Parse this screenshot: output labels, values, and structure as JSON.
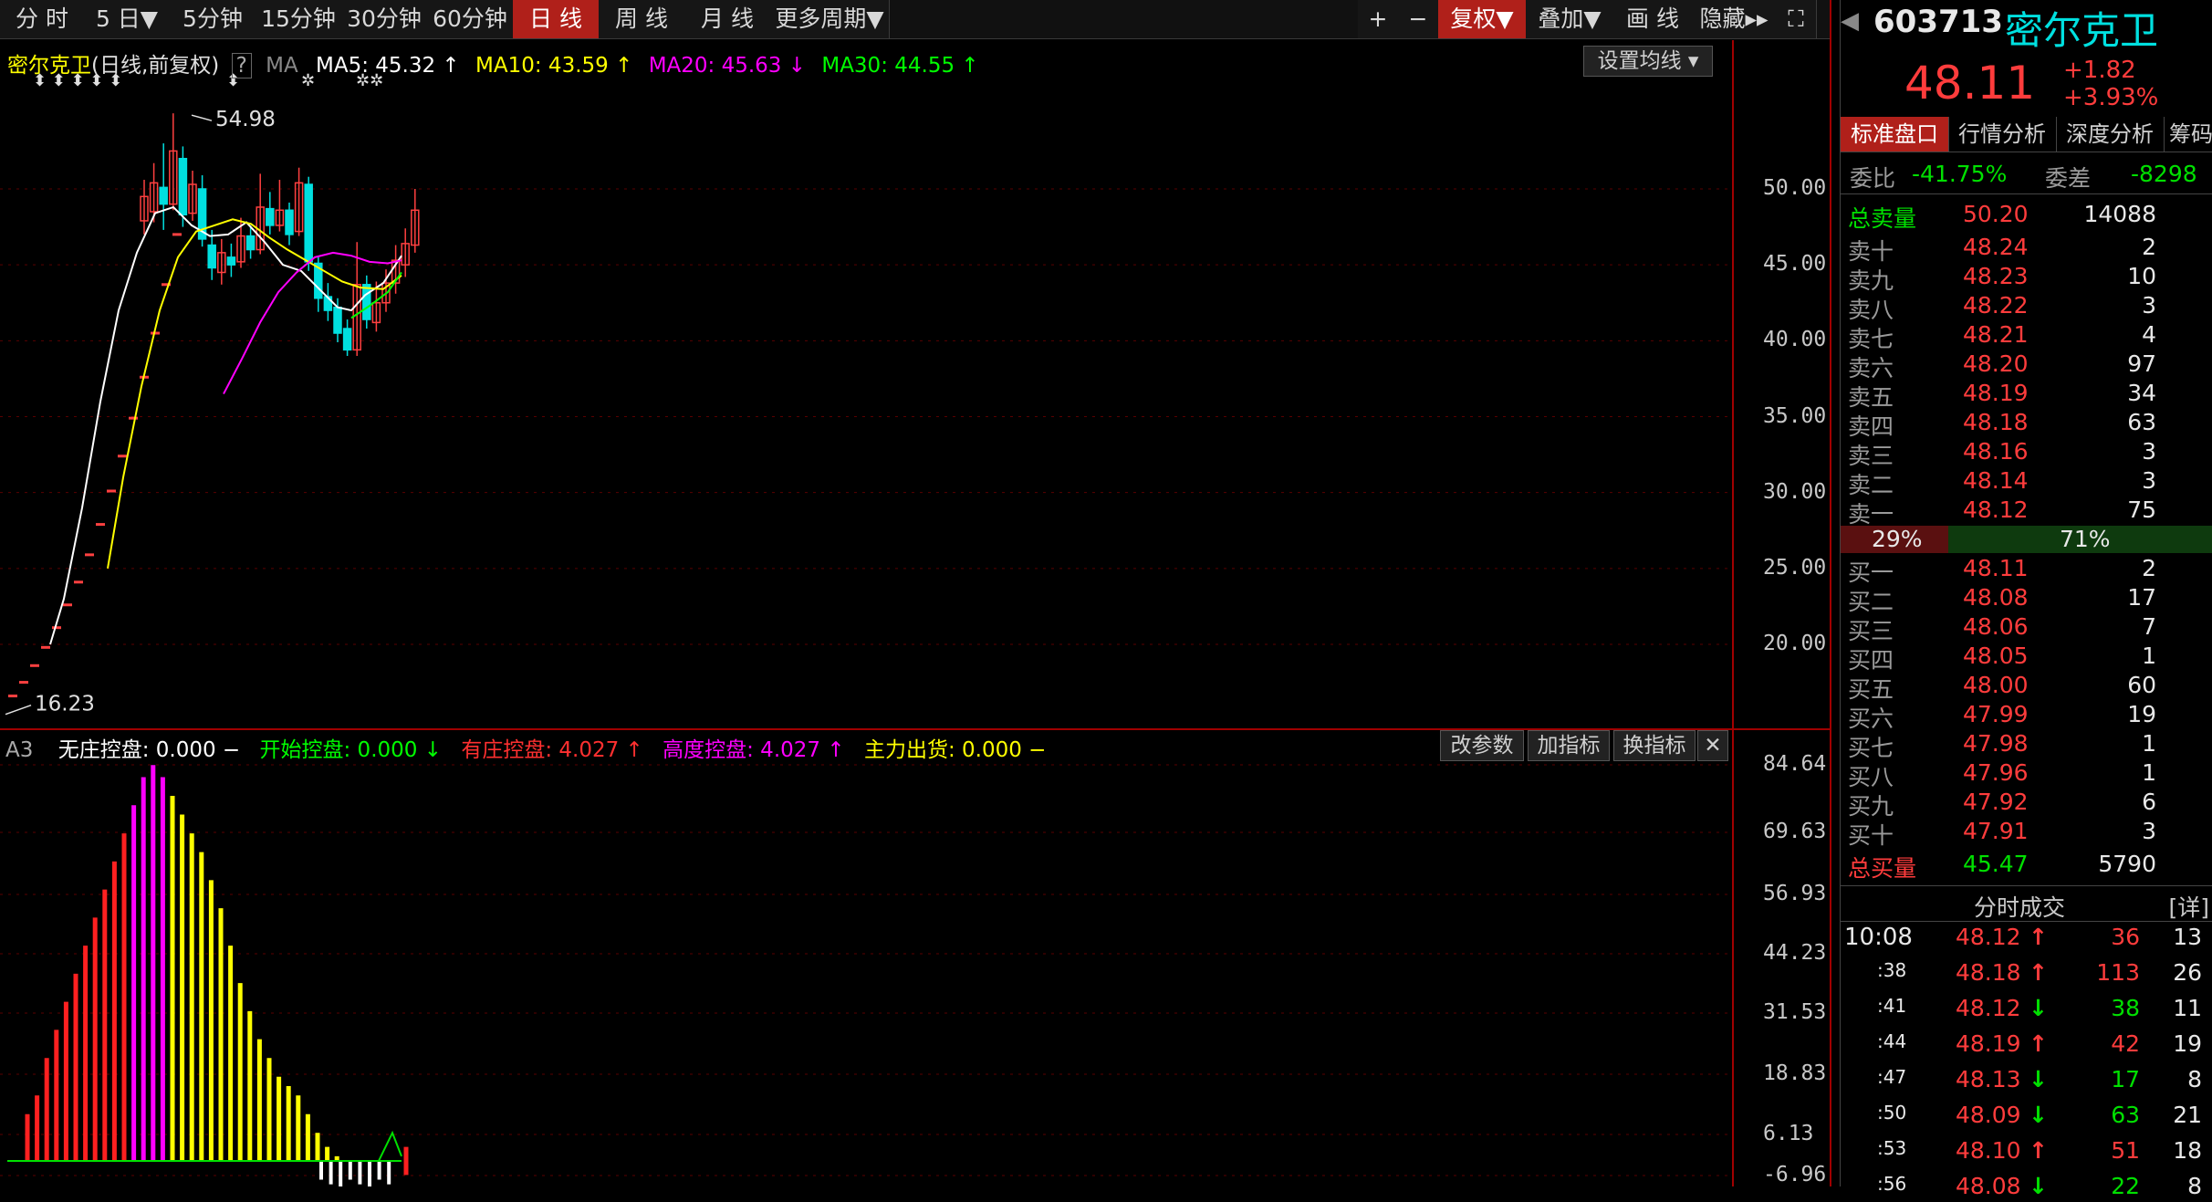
{
  "toolbar": {
    "periods": [
      "分 时",
      "5 日▼",
      "5分钟",
      "15分钟",
      "30分钟",
      "60分钟",
      "日 线",
      "周 线",
      "月 线",
      "更多周期▼"
    ],
    "active_index": 6,
    "right_buttons": [
      "+",
      "−",
      "复权▼",
      "叠加▼",
      "画 线",
      "隐藏▸▸",
      "⛶"
    ]
  },
  "chart": {
    "stock_name": "密尔克卫",
    "period_desc": "(日线,前复权)",
    "help": "?",
    "ma_label": "MA",
    "ma5": "MA5: 45.32",
    "ma10": "MA10: 43.59",
    "ma20": "MA20: 45.63",
    "ma30": "MA30: 44.55",
    "ma_set_button": "设置均线 ▾",
    "high_label": "54.98",
    "low_label": "16.23",
    "marks": [
      "⬍ ⬍  ⬍ ⬍ ⬍",
      "⬍",
      "✲",
      "✲✲"
    ],
    "price_axis": [
      "50.00",
      "45.00",
      "40.00",
      "35.00",
      "30.00",
      "25.00",
      "20.00"
    ],
    "colors": {
      "up": "#ff4040",
      "down": "#00e0e0",
      "ma5": "#ffffff",
      "ma10": "#ffff00",
      "ma20": "#ff00ff",
      "ma30": "#00ff00"
    }
  },
  "indicator": {
    "tag": "A3",
    "wzkp": "无庄控盘: 0.000",
    "kskp": "开始控盘: 0.000",
    "yzkp": "有庄控盘: 4.027",
    "gdkp": "高度控盘: 4.027",
    "zlch": "主力出货: 0.000",
    "buttons": [
      "改参数",
      "加指标",
      "换指标",
      "✕"
    ],
    "axis": [
      "84.64",
      "69.63",
      "56.93",
      "44.23",
      "31.53",
      "18.83",
      "6.13",
      "-6.96"
    ]
  },
  "quote": {
    "code": "603713",
    "name": "密尔克卫",
    "price": "48.11",
    "change": "+1.82",
    "change_pct": "+3.93%",
    "tabs": [
      "标准盘口",
      "行情分析",
      "深度分析",
      "筹码"
    ],
    "weibi_label": "委比",
    "weibi": "-41.75%",
    "weicha_label": "委差",
    "weicha": "-8298",
    "total_sell": {
      "label": "总卖量",
      "price": "50.20",
      "vol": "14088"
    },
    "sells": [
      {
        "label": "卖十",
        "price": "48.24",
        "vol": "2"
      },
      {
        "label": "卖九",
        "price": "48.23",
        "vol": "10"
      },
      {
        "label": "卖八",
        "price": "48.22",
        "vol": "3"
      },
      {
        "label": "卖七",
        "price": "48.21",
        "vol": "4"
      },
      {
        "label": "卖六",
        "price": "48.20",
        "vol": "97"
      },
      {
        "label": "卖五",
        "price": "48.19",
        "vol": "34"
      },
      {
        "label": "卖四",
        "price": "48.18",
        "vol": "63"
      },
      {
        "label": "卖三",
        "price": "48.16",
        "vol": "3"
      },
      {
        "label": "卖二",
        "price": "48.14",
        "vol": "3"
      },
      {
        "label": "卖一",
        "price": "48.12",
        "vol": "75"
      }
    ],
    "ratio_left": "29%",
    "ratio_right": "71%",
    "ratio_value": 0.29,
    "buys": [
      {
        "label": "买一",
        "price": "48.11",
        "vol": "2"
      },
      {
        "label": "买二",
        "price": "48.08",
        "vol": "17"
      },
      {
        "label": "买三",
        "price": "48.06",
        "vol": "7"
      },
      {
        "label": "买四",
        "price": "48.05",
        "vol": "1"
      },
      {
        "label": "买五",
        "price": "48.00",
        "vol": "60"
      },
      {
        "label": "买六",
        "price": "47.99",
        "vol": "19"
      },
      {
        "label": "买七",
        "price": "47.98",
        "vol": "1"
      },
      {
        "label": "买八",
        "price": "47.96",
        "vol": "1"
      },
      {
        "label": "买九",
        "price": "47.92",
        "vol": "6"
      },
      {
        "label": "买十",
        "price": "47.91",
        "vol": "3"
      }
    ],
    "total_buy": {
      "label": "总买量",
      "price": "45.47",
      "vol": "5790"
    },
    "ticks_title": "分时成交",
    "ticks_detail": "[详]",
    "ticks": [
      {
        "time": "10:08",
        "price": "48.12",
        "dir": "up",
        "vol": "36",
        "n": "13"
      },
      {
        "time": ":38",
        "price": "48.18",
        "dir": "up",
        "vol": "113",
        "n": "26"
      },
      {
        "time": ":41",
        "price": "48.12",
        "dir": "down",
        "vol": "38",
        "n": "11"
      },
      {
        "time": ":44",
        "price": "48.19",
        "dir": "up",
        "vol": "42",
        "n": "19"
      },
      {
        "time": ":47",
        "price": "48.13",
        "dir": "down",
        "vol": "17",
        "n": "8"
      },
      {
        "time": ":50",
        "price": "48.09",
        "dir": "down",
        "vol": "63",
        "n": "21"
      },
      {
        "time": ":53",
        "price": "48.10",
        "dir": "up",
        "vol": "51",
        "n": "18"
      },
      {
        "time": ":56",
        "price": "48.08",
        "dir": "down",
        "vol": "22",
        "n": "8"
      }
    ]
  }
}
